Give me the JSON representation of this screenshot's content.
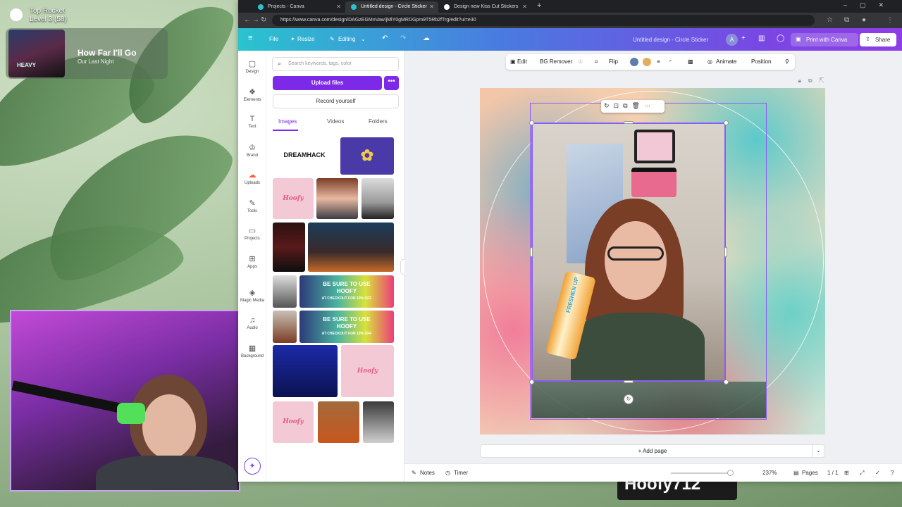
{
  "overlay": {
    "achievement_title": "Top Rocket",
    "achievement_level": "Level 3 (58)",
    "now_playing_song": "How Far I'll Go",
    "now_playing_artist": "Our Last Night",
    "cover_text": "HEAVY",
    "brand_bar_text": "Hoofy712"
  },
  "browser": {
    "tabs": [
      {
        "label": "Projects - Canva",
        "active": false
      },
      {
        "label": "Untitled design - Circle Sticker",
        "active": true
      },
      {
        "label": "Design new Kiss Cut Stickers",
        "active": false
      }
    ],
    "url": "https://www.canva.com/design/DAGzEGMnVaw/jMlY0gMRDGpm9T5Rb2fTrg/edit?ui=e30"
  },
  "canva_bar": {
    "file": "File",
    "resize": "Resize",
    "mode": "Editing",
    "doc_title": "Untitled design - Circle Sticker",
    "avatar_letter": "A",
    "print": "Print with Canva",
    "share": "Share"
  },
  "rail": {
    "items": [
      {
        "label": "Design",
        "icon": "▢"
      },
      {
        "label": "Elements",
        "icon": "❖"
      },
      {
        "label": "Text",
        "icon": "T"
      },
      {
        "label": "Brand",
        "icon": "♔"
      },
      {
        "label": "Uploads",
        "icon": "☁"
      },
      {
        "label": "Tools",
        "icon": "✎"
      },
      {
        "label": "Projects",
        "icon": "▭"
      },
      {
        "label": "Apps",
        "icon": "⊞"
      },
      {
        "label": "Magic Media",
        "icon": "◈"
      },
      {
        "label": "Audio",
        "icon": "♫"
      },
      {
        "label": "Background",
        "icon": "▦"
      }
    ]
  },
  "panel": {
    "search_placeholder": "Search keywords, tags, color",
    "upload": "Upload files",
    "more": "•••",
    "record": "Record yourself",
    "tabs": [
      "Images",
      "Videos",
      "Folders"
    ],
    "thumbs": {
      "dreamhack": "DREAMHACK",
      "hoofy": "Hoofy",
      "promo_line1": "BE SURE TO USE",
      "promo_line2": "HOOFY",
      "promo_line3": "AT CHECKOUT FOR 10% OFF",
      "energy": "FRESHEN UP ENERGY"
    }
  },
  "toolbar": {
    "edit": "Edit",
    "bg_remover": "BG Remover",
    "flip": "Flip",
    "animate": "Animate",
    "position": "Position",
    "swatch_1": "#5b7fa6",
    "swatch_2": "#e0b060"
  },
  "canvas": {
    "can_label": "FRESHEN UP",
    "add_page": "+ Add page"
  },
  "footer": {
    "notes": "Notes",
    "timer": "Timer",
    "zoom": "237%",
    "pages": "Pages",
    "page_count": "1 / 1"
  },
  "colors": {
    "accent": "#7d2ae8",
    "selection": "#8b5cf6"
  }
}
